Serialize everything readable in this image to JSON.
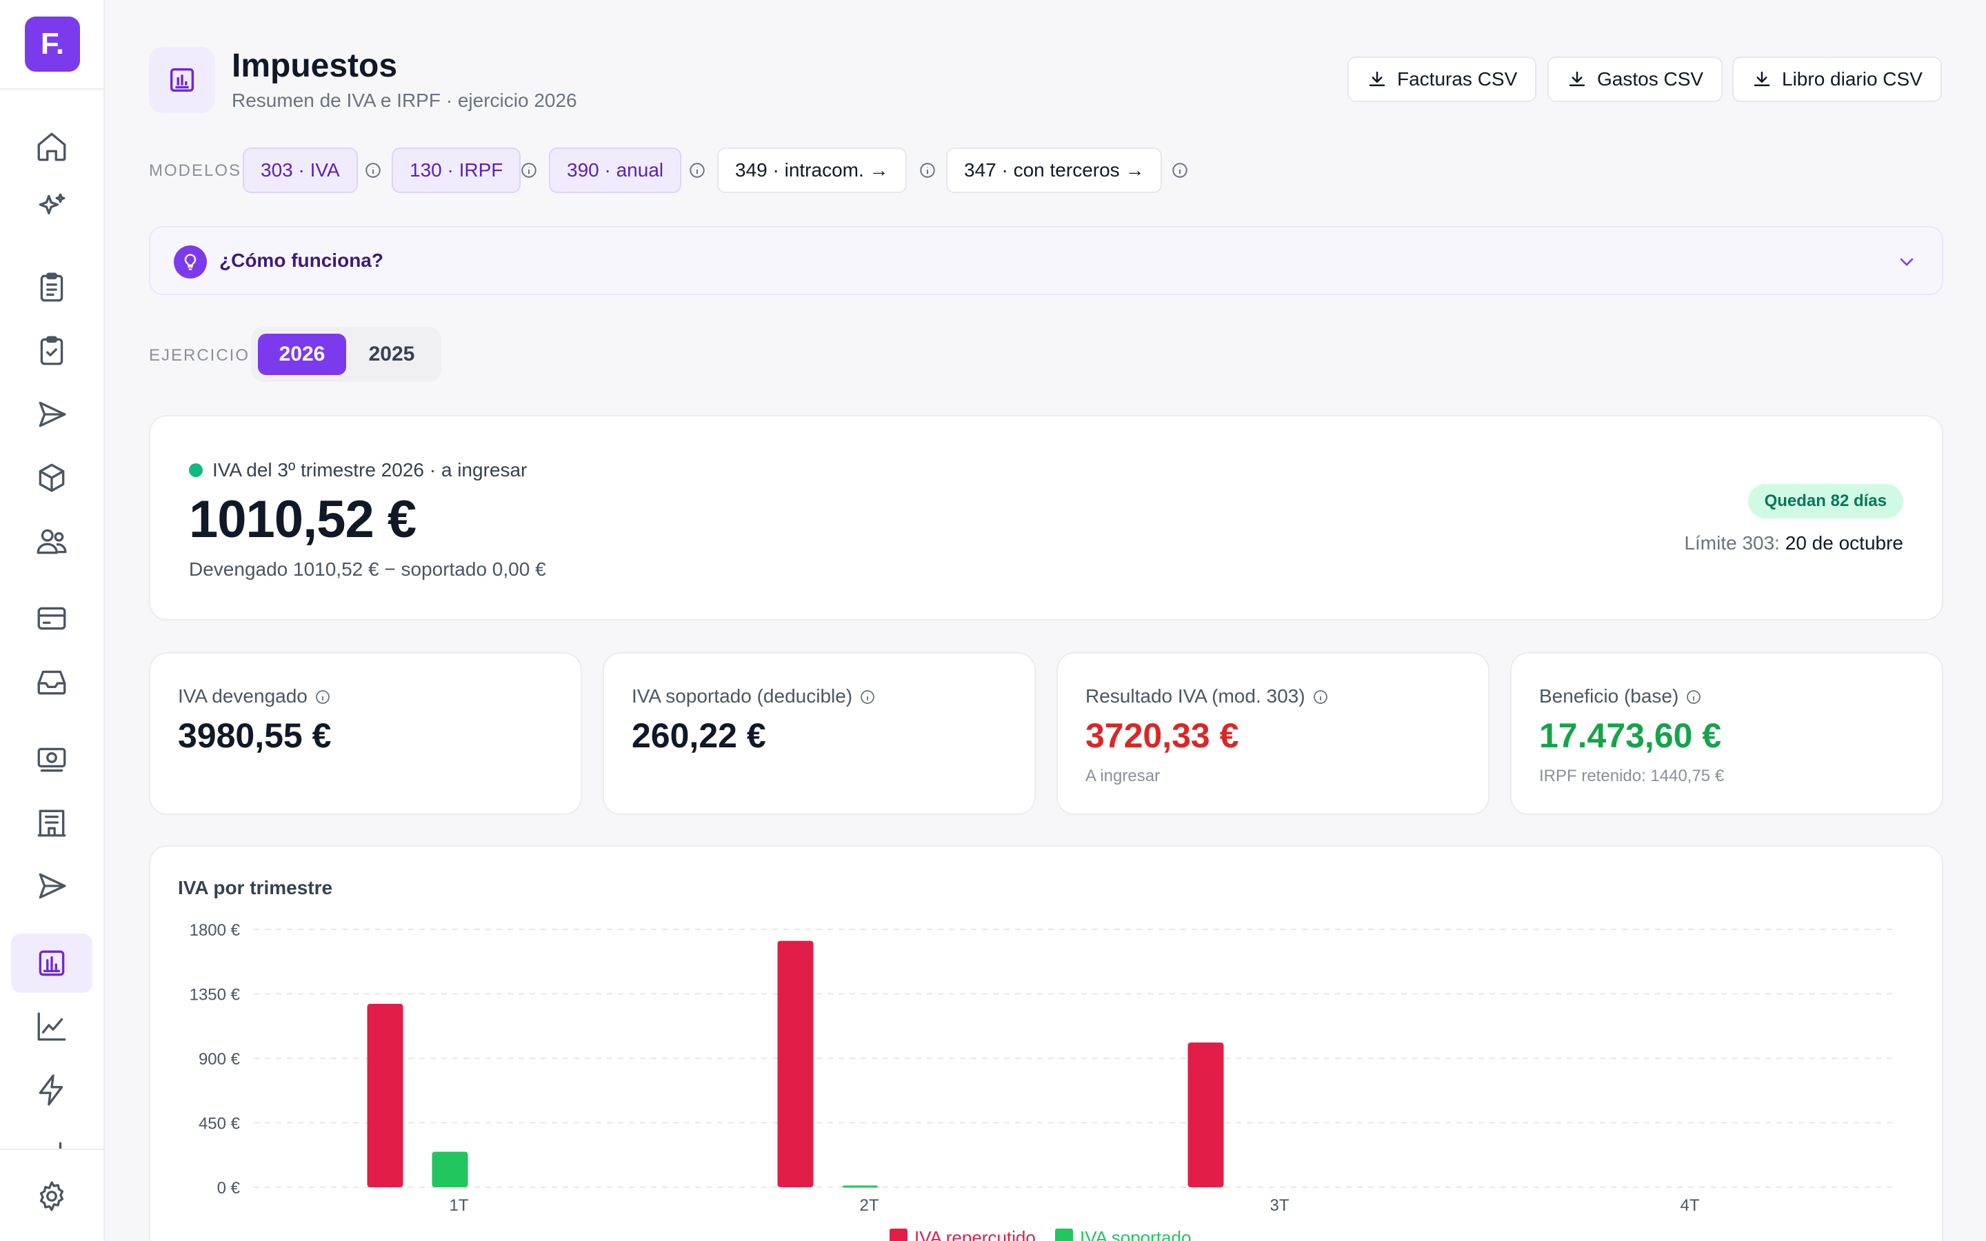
{
  "sidebar": {
    "logo": "F.",
    "icons": [
      "home-icon",
      "sparkles-icon",
      "clipboard-list-icon",
      "clipboard-check-icon",
      "send-icon",
      "box-icon",
      "users-icon",
      "credit-card-icon",
      "inbox-icon",
      "banknote-icon",
      "building-icon",
      "send-alt-icon",
      "report-icon",
      "line-chart-icon",
      "bolt-icon",
      "bar-chart-icon",
      "settings-icon"
    ],
    "active": "report-icon"
  },
  "header": {
    "title": "Impuestos",
    "subtitle": "Resumen de IVA e IRPF · ejercicio 2026",
    "exports": [
      "Facturas CSV",
      "Gastos CSV",
      "Libro diario CSV"
    ]
  },
  "models": {
    "label": "MODELOS",
    "chips": [
      "303 · IVA",
      "130 · IRPF",
      "390 · anual",
      "349 · intracom. →",
      "347 · con terceros →"
    ]
  },
  "how": {
    "label": "¿Cómo funciona?"
  },
  "year": {
    "label": "EJERCICIO",
    "options": [
      "2026",
      "2025"
    ],
    "selected": "2026"
  },
  "hero": {
    "label": "IVA del 3º trimestre 2026 · a ingresar",
    "amount": "1010,52 €",
    "detail": "Devengado 1010,52 € − soportado 0,00 €",
    "badge": "Quedan 82 días",
    "limit_label": "Límite 303:",
    "limit_value": "20 de octubre"
  },
  "kpis": [
    {
      "label": "IVA devengado",
      "value": "3980,55 €",
      "sub": ""
    },
    {
      "label": "IVA soportado (deducible)",
      "value": "260,22 €",
      "sub": ""
    },
    {
      "label": "Resultado IVA (mod. 303)",
      "value": "3720,33 €",
      "sub": "A ingresar"
    },
    {
      "label": "Beneficio (base)",
      "value": "17.473,60 €",
      "sub": "IRPF retenido: 1440,75 €"
    }
  ],
  "colors": {
    "accent": "#7c3aed",
    "repercutido": "#e11d48",
    "soportado": "#22c55e",
    "negative": "#dc2626",
    "positive": "#16a34a"
  },
  "chart_data": {
    "type": "bar",
    "title": "IVA por trimestre",
    "categories": [
      "1T",
      "2T",
      "3T",
      "4T"
    ],
    "series": [
      {
        "name": "IVA repercutido",
        "values": [
          1280,
          1720,
          1010,
          0
        ]
      },
      {
        "name": "IVA soportado",
        "values": [
          248,
          12,
          0,
          0
        ]
      }
    ],
    "ylim": [
      0,
      1800
    ],
    "yticks": [
      0,
      450,
      900,
      1350,
      1800
    ],
    "ytick_labels": [
      "0 €",
      "450 €",
      "900 €",
      "1350 €",
      "1800 €"
    ],
    "grid": true,
    "legend": "bottom-center"
  }
}
